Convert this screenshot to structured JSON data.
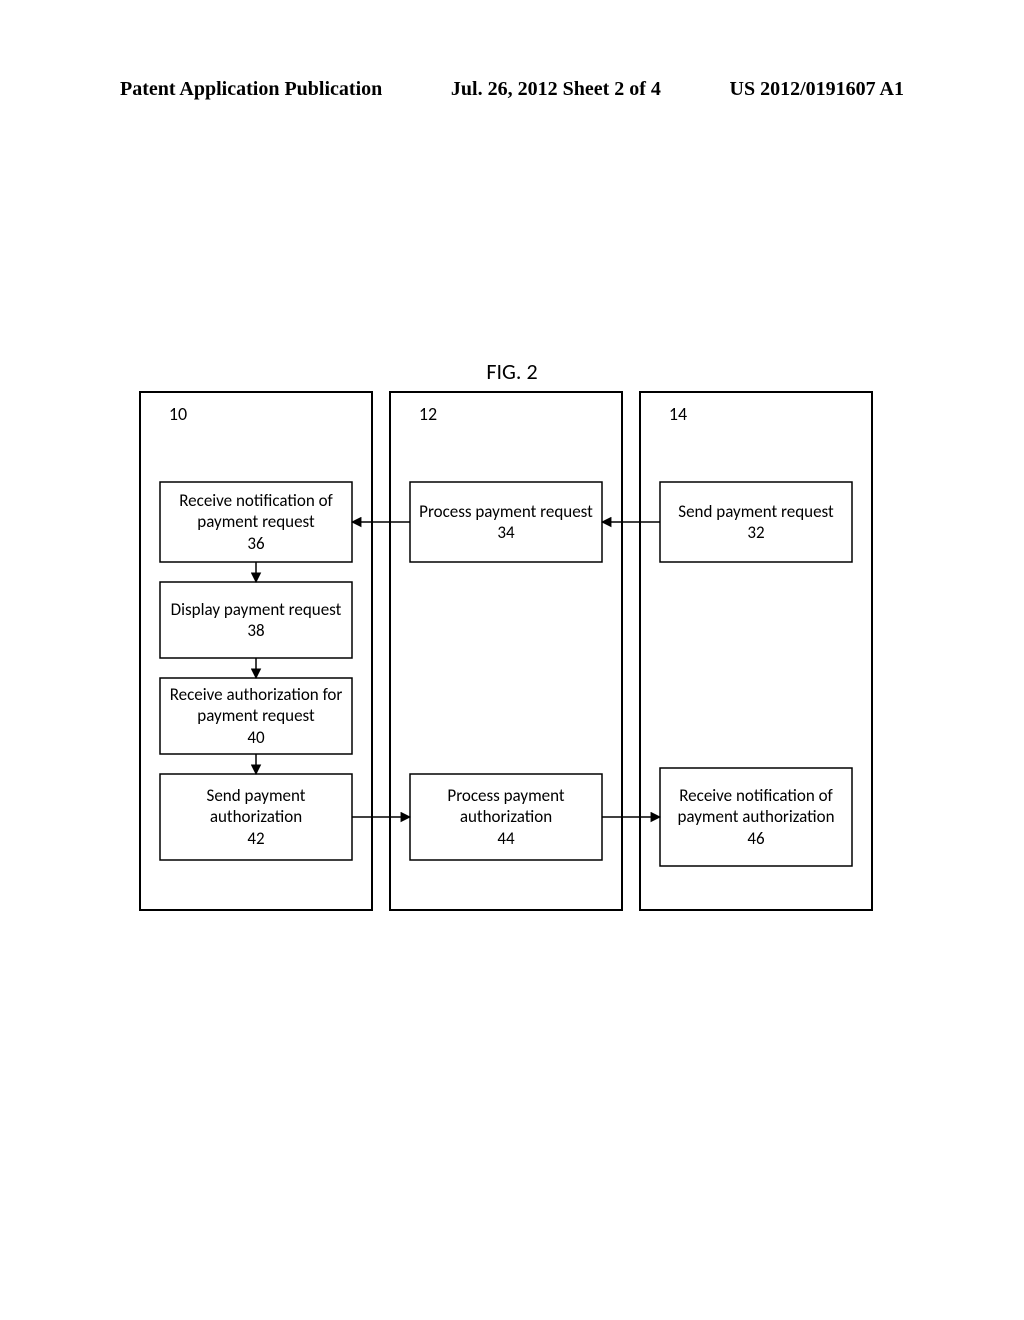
{
  "header": {
    "left": "Patent Application Publication",
    "center": "Jul. 26, 2012  Sheet 2 of 4",
    "right": "US 2012/0191607 A1"
  },
  "figure_title": "FIG. 2",
  "columns": {
    "c1": "10",
    "c2": "12",
    "c3": "14"
  },
  "boxes": {
    "b32": {
      "text": "Send payment request",
      "num": "32"
    },
    "b34": {
      "text": "Process payment request",
      "num": "34"
    },
    "b36": {
      "text": "Receive notification of payment request",
      "num": "36"
    },
    "b38": {
      "text": "Display payment request",
      "num": "38"
    },
    "b40": {
      "text": "Receive authorization for payment request",
      "num": "40"
    },
    "b42": {
      "text": "Send payment authorization",
      "num": "42"
    },
    "b44": {
      "text": "Process payment authorization",
      "num": "44"
    },
    "b46": {
      "text": "Receive notification of payment authorization",
      "num": "46"
    }
  },
  "chart_data": {
    "type": "diagram",
    "title": "FIG. 2",
    "swimlanes": [
      {
        "id": "10",
        "label": "10"
      },
      {
        "id": "12",
        "label": "12"
      },
      {
        "id": "14",
        "label": "14"
      }
    ],
    "nodes": [
      {
        "id": 32,
        "lane": "14",
        "label": "Send payment request"
      },
      {
        "id": 34,
        "lane": "12",
        "label": "Process payment request"
      },
      {
        "id": 36,
        "lane": "10",
        "label": "Receive notification of payment request"
      },
      {
        "id": 38,
        "lane": "10",
        "label": "Display payment request"
      },
      {
        "id": 40,
        "lane": "10",
        "label": "Receive authorization for payment request"
      },
      {
        "id": 42,
        "lane": "10",
        "label": "Send payment authorization"
      },
      {
        "id": 44,
        "lane": "12",
        "label": "Process payment authorization"
      },
      {
        "id": 46,
        "lane": "14",
        "label": "Receive notification of payment authorization"
      }
    ],
    "edges": [
      {
        "from": 32,
        "to": 34
      },
      {
        "from": 34,
        "to": 36
      },
      {
        "from": 36,
        "to": 38
      },
      {
        "from": 38,
        "to": 40
      },
      {
        "from": 40,
        "to": 42
      },
      {
        "from": 42,
        "to": 44
      },
      {
        "from": 44,
        "to": 46
      }
    ]
  }
}
